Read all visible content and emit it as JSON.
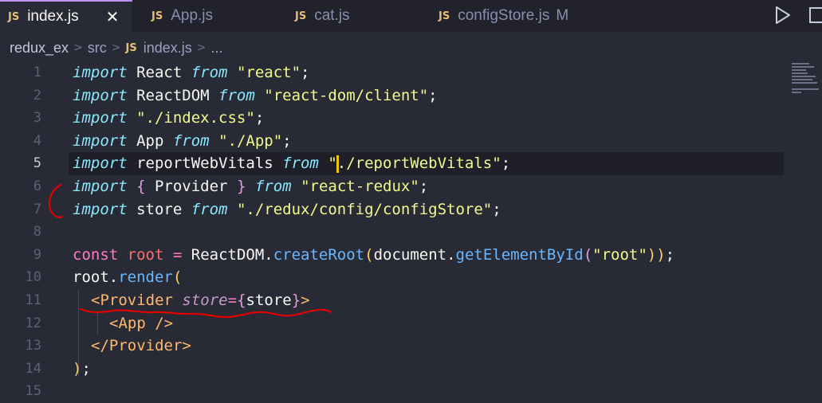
{
  "tabs": [
    {
      "badge": "JS",
      "label": "index.js",
      "close": "✕",
      "active": true
    },
    {
      "badge": "JS",
      "label": "App.js",
      "active": false
    },
    {
      "badge": "JS",
      "label": "cat.js",
      "active": false
    },
    {
      "badge": "JS",
      "label": "configStore.js",
      "modified": "M",
      "active": false
    }
  ],
  "breadcrumb": {
    "seg1": "redux_ex",
    "seg2": "src",
    "badge": "JS",
    "seg3": "index.js",
    "seg4": "..."
  },
  "lines": {
    "n": [
      "1",
      "2",
      "3",
      "4",
      "5",
      "6",
      "7",
      "8",
      "9",
      "10",
      "11",
      "12",
      "13",
      "14",
      "15"
    ],
    "l1": [
      "import",
      " React ",
      "from",
      " ",
      "\"react\"",
      ";"
    ],
    "l2": [
      "import",
      " ReactDOM ",
      "from",
      " ",
      "\"react-dom/client\"",
      ";"
    ],
    "l3": [
      "import",
      " ",
      "\"./index.css\"",
      ";"
    ],
    "l4": [
      "import",
      " App ",
      "from",
      " ",
      "\"./App\"",
      ";"
    ],
    "l5": [
      "import",
      " reportWebVitals ",
      "from",
      " ",
      "\"",
      "./reportWebVitals\"",
      ";"
    ],
    "l6": [
      "import",
      " ",
      "{",
      " Provider ",
      "}",
      " ",
      "from",
      " ",
      "\"react-redux\"",
      ";"
    ],
    "l7": [
      "import",
      " store ",
      "from",
      " ",
      "\"./redux/config/configStore\"",
      ";"
    ],
    "l9": [
      "const",
      " ",
      "root",
      " = ",
      "ReactDOM",
      ".",
      "createRoot",
      "(",
      "document",
      ".",
      "getElementById",
      "(",
      "\"root\"",
      "))",
      ";"
    ],
    "l10": [
      "root",
      ".",
      "render",
      "("
    ],
    "l11": [
      "<Provider",
      " ",
      "store",
      "=",
      "{",
      "store",
      "}",
      ">"
    ],
    "l12": [
      "<App />"
    ],
    "l13": [
      "</Provider>"
    ],
    "l14": [
      ")",
      ";"
    ]
  },
  "colors": {
    "background": "#282a36",
    "keyword": "#8be9fd",
    "string": "#f1fa8c",
    "annotation": "#e00000"
  },
  "icons": {
    "run": "play-icon",
    "split": "split-editor-icon"
  }
}
